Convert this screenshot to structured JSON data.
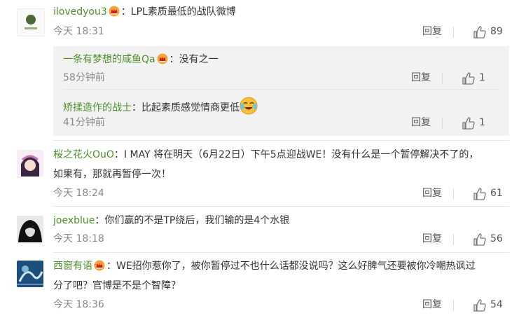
{
  "comments": [
    {
      "user": "ilovedyou3",
      "text": "：LPL素质最低的战队微博",
      "time": "今天 18:31",
      "reply": "回复",
      "likes": "89",
      "replies": [
        {
          "user": "一条有梦想的咸鱼Qa",
          "text": "：没有之一",
          "time": "58分钟前",
          "reply": "回复",
          "likes": "1"
        },
        {
          "user": "矫揉造作的战士",
          "text": "：比起素质感觉情商更低",
          "time": "41分钟前",
          "reply": "回复",
          "likes": "1"
        }
      ]
    },
    {
      "user": "桜之花火OuO",
      "text": "：I MAY 将在明天（6月22日）下午5点迎战WE！没有什么是一个暂停解决不了的，",
      "text2": "如果有，那就再暂停一次！",
      "time": "今天 18:24",
      "reply": "回复",
      "likes": "61"
    },
    {
      "user": "joexblue",
      "text": "：你们赢的不是TP绕后，我们输的是4个水银",
      "time": "今天 18:18",
      "reply": "回复",
      "likes": "56"
    },
    {
      "user": "西窗有语",
      "text": "：WE招你惹你了，被你暂停过不也什么话都没说吗？这么好脾气还要被你冷嘲热讽过",
      "text2": "分了吧？官博是不是个智障？",
      "time": "今天 18:36",
      "reply": "回复",
      "likes": "54"
    }
  ],
  "icons": {
    "like": "thumbs-up-icon",
    "crown": "vip-crown-icon",
    "emoji": "crying-laughing-emoji-icon"
  }
}
